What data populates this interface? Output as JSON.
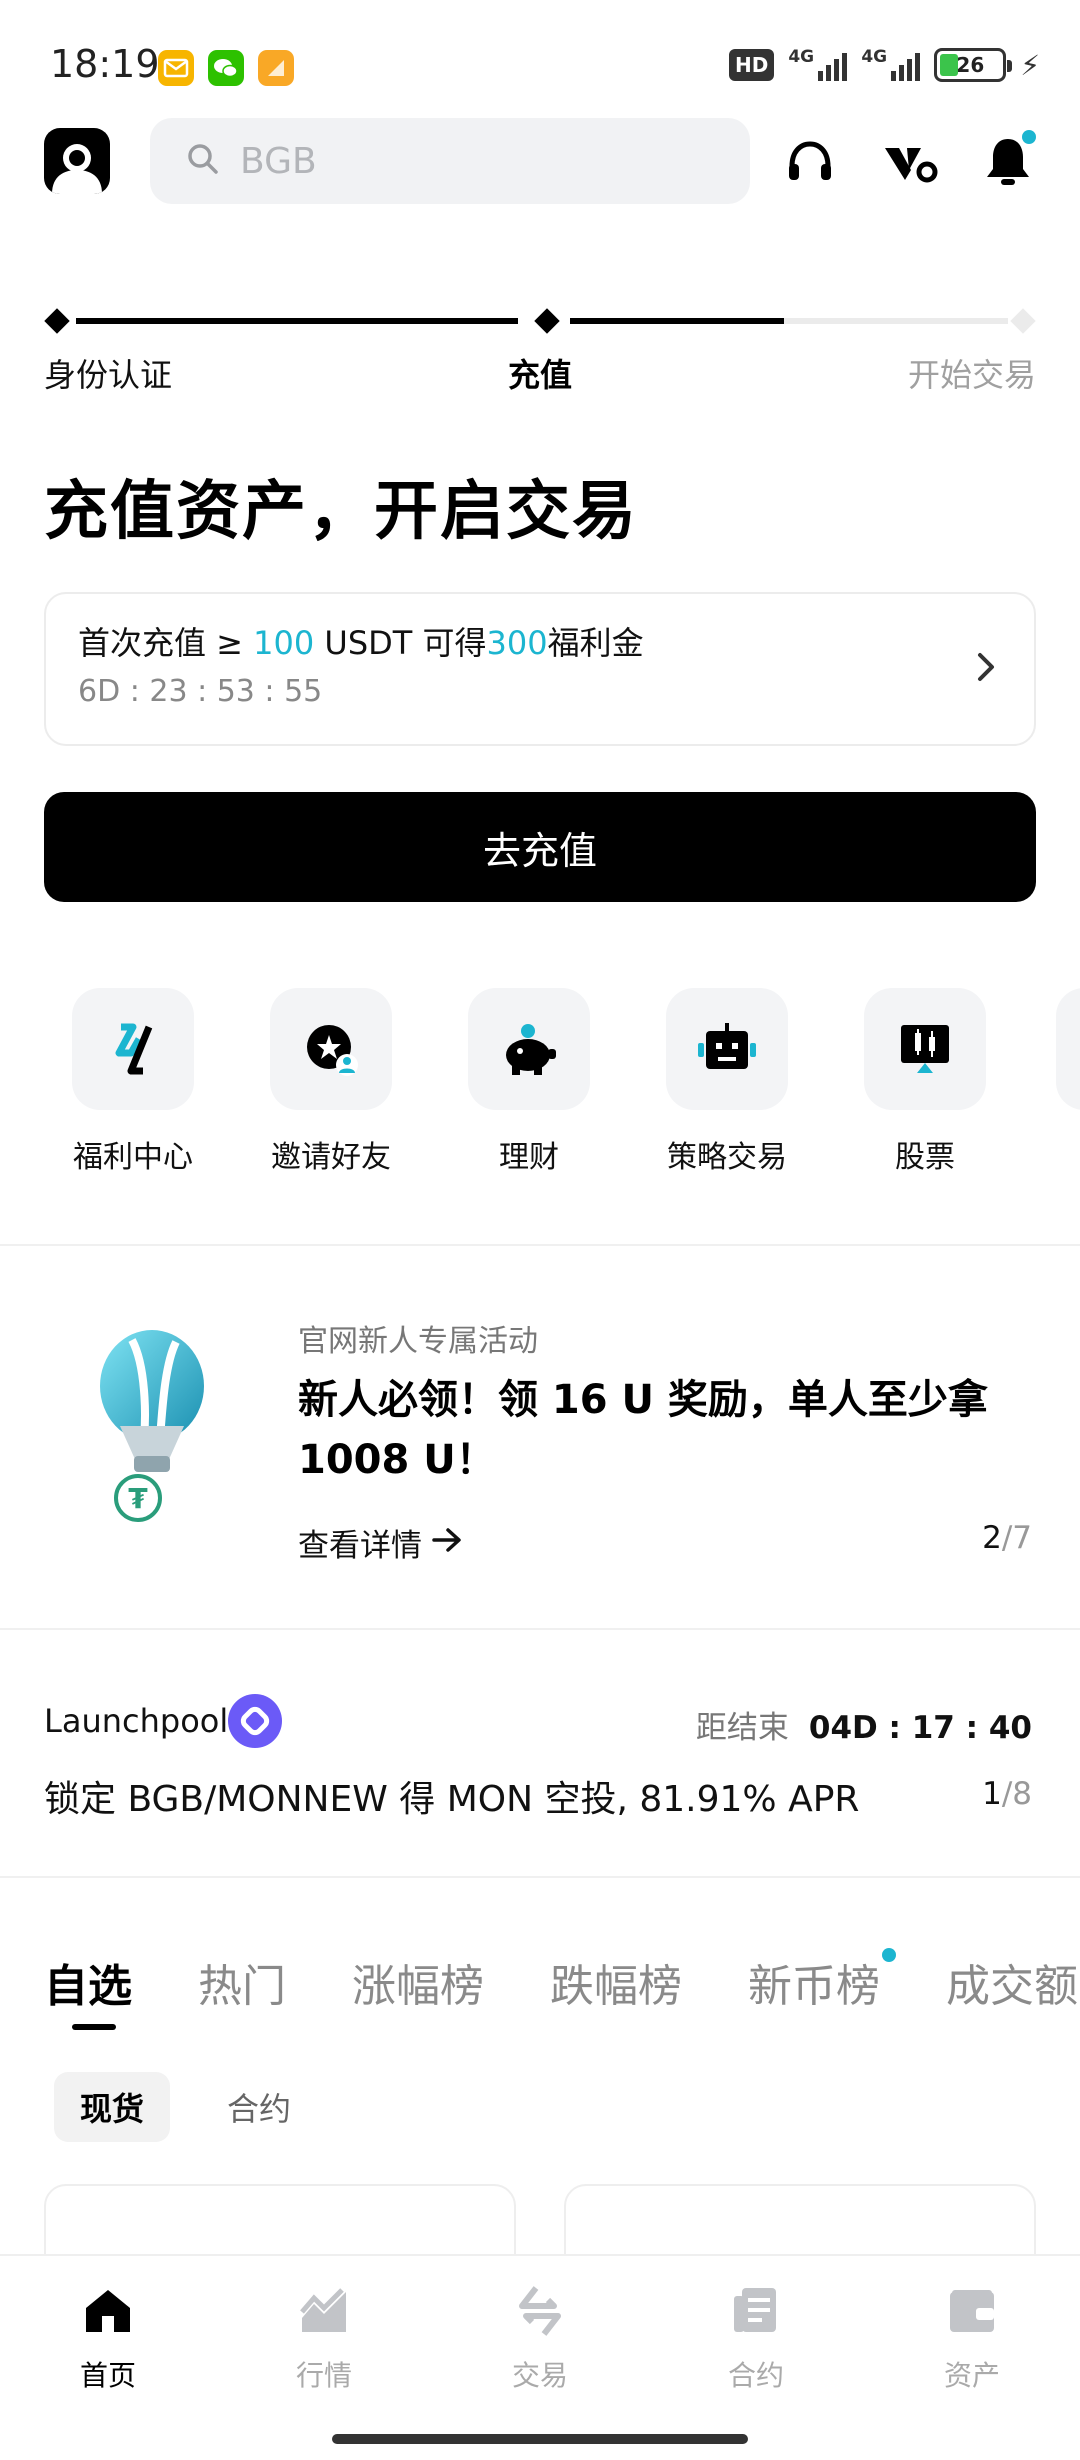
{
  "status_bar": {
    "time": "18:19",
    "hd_label": "HD",
    "network1": "4G",
    "network2": "4G",
    "battery": "26",
    "app_icons": [
      "mail-icon",
      "wechat-icon",
      "notes-icon"
    ]
  },
  "header": {
    "search_placeholder": "BGB",
    "icons": [
      "avatar-icon",
      "headset-icon",
      "wallet-logo-icon",
      "bell-icon"
    ]
  },
  "progress": {
    "steps": [
      {
        "label": "身份认证",
        "state": "done"
      },
      {
        "label": "充值",
        "state": "current"
      },
      {
        "label": "开始交易",
        "state": "pending"
      }
    ]
  },
  "main": {
    "title": "充值资产，开启交易",
    "promo": {
      "prefix": "首次充值 ≥ ",
      "amount": "100",
      "unit": " USDT 可得",
      "reward": "300",
      "suffix": "福利金",
      "countdown": "6D : 23 : 53 : 55"
    },
    "deposit_button": "去充值"
  },
  "shortcuts": [
    {
      "label": "福利中心",
      "icon": "welfare-icon"
    },
    {
      "label": "邀请好友",
      "icon": "invite-icon"
    },
    {
      "label": "理财",
      "icon": "piggy-bank-icon"
    },
    {
      "label": "策略交易",
      "icon": "robot-icon"
    },
    {
      "label": "股票",
      "icon": "stock-chart-icon"
    }
  ],
  "banner": {
    "tag": "官网新人专属活动",
    "title": "新人必领！领 16 U 奖励，单人至少拿 1008 U！",
    "link": "查看详情",
    "page_current": "2",
    "page_total": "/7"
  },
  "launchpool": {
    "name": "Launchpool",
    "end_label": "距结束",
    "end_time": "04D : 17 : 40",
    "desc": "锁定 BGB/MONNEW 得 MON 空投, 81.91% APR",
    "page_current": "1",
    "page_total": "/8"
  },
  "market_tabs": [
    "自选",
    "热门",
    "涨幅榜",
    "跌幅榜",
    "新币榜",
    "成交额"
  ],
  "sub_tabs": [
    "现货",
    "合约"
  ],
  "bottom_nav": [
    {
      "label": "首页",
      "icon": "home-icon",
      "active": true
    },
    {
      "label": "行情",
      "icon": "market-chart-icon",
      "active": false
    },
    {
      "label": "交易",
      "icon": "trade-icon",
      "active": false
    },
    {
      "label": "合约",
      "icon": "contract-icon",
      "active": false
    },
    {
      "label": "资产",
      "icon": "assets-wallet-icon",
      "active": false
    }
  ],
  "colors": {
    "accent": "#1cb5d0",
    "primary": "#000000",
    "muted": "#8a8a8a"
  }
}
